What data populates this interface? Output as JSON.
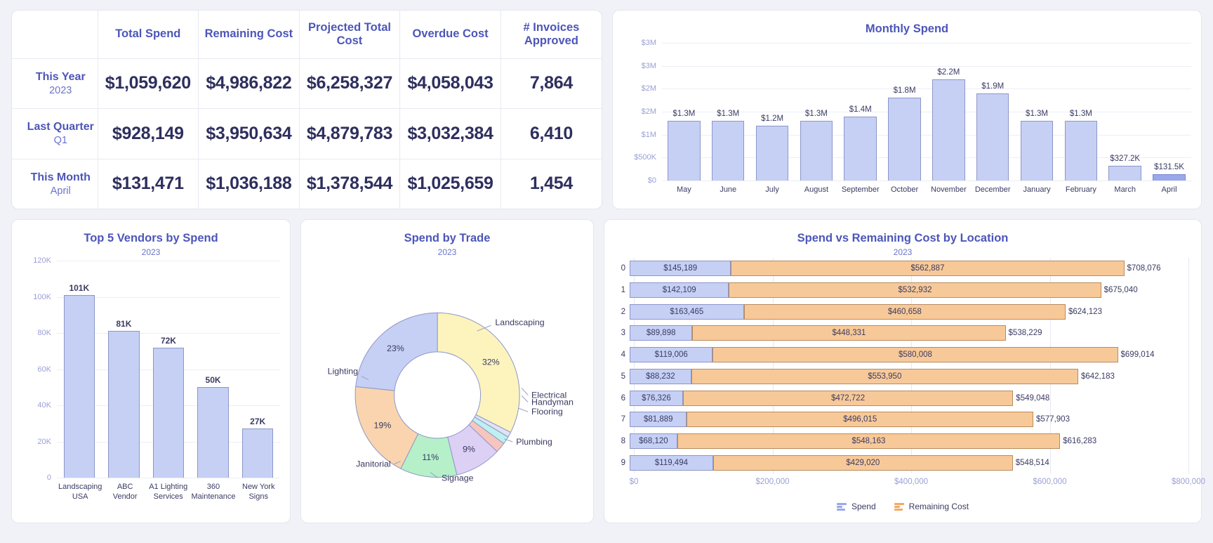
{
  "kpi_table": {
    "columns": [
      "",
      "Total Spend",
      "Remaining Cost",
      "Projected Total Cost",
      "Overdue Cost",
      "# Invoices Approved"
    ],
    "rows": [
      {
        "label": "This Year",
        "sub": "2023",
        "total_spend": "$1,059,620",
        "remaining_cost": "$4,986,822",
        "projected_total_cost": "$6,258,327",
        "overdue_cost": "$4,058,043",
        "invoices_approved": "7,864"
      },
      {
        "label": "Last Quarter",
        "sub": "Q1",
        "total_spend": "$928,149",
        "remaining_cost": "$3,950,634",
        "projected_total_cost": "$4,879,783",
        "overdue_cost": "$3,032,384",
        "invoices_approved": "6,410"
      },
      {
        "label": "This Month",
        "sub": "April",
        "total_spend": "$131,471",
        "remaining_cost": "$1,036,188",
        "projected_total_cost": "$1,378,544",
        "overdue_cost": "$1,025,659",
        "invoices_approved": "1,454"
      }
    ]
  },
  "monthly_spend": {
    "title": "Monthly Spend"
  },
  "top_vendors": {
    "title": "Top 5 Vendors by Spend",
    "subtitle": "2023"
  },
  "spend_by_trade": {
    "title": "Spend by Trade",
    "subtitle": "2023"
  },
  "location": {
    "title": "Spend vs Remaining Cost by Location",
    "subtitle": "2023",
    "legend": [
      {
        "name": "Spend",
        "color": "#9aa8ec"
      },
      {
        "name": "Remaining Cost",
        "color": "#f5a960"
      }
    ]
  },
  "chart_data": [
    {
      "id": "monthly_spend",
      "type": "bar",
      "title": "Monthly Spend",
      "xlabel": "",
      "ylabel": "",
      "grid": true,
      "legend": "none",
      "ylim": [
        0,
        3000000
      ],
      "ytick_labels": [
        "$3M",
        "$3M",
        "$2M",
        "$2M",
        "$1M",
        "$500K",
        "$0"
      ],
      "ytick_values": [
        3000000,
        2500000,
        2000000,
        1500000,
        1000000,
        500000,
        0
      ],
      "categories": [
        "May",
        "June",
        "July",
        "August",
        "September",
        "October",
        "November",
        "December",
        "January",
        "February",
        "March",
        "April"
      ],
      "values": [
        1300000,
        1300000,
        1200000,
        1300000,
        1400000,
        1800000,
        2200000,
        1900000,
        1300000,
        1300000,
        327200,
        131500
      ],
      "data_labels": [
        "$1.3M",
        "$1.3M",
        "$1.2M",
        "$1.3M",
        "$1.4M",
        "$1.8M",
        "$2.2M",
        "$1.9M",
        "$1.3M",
        "$1.3M",
        "$327.2K",
        "$131.5K"
      ],
      "highlight_index": 11,
      "bar_color": "#c6d0f5",
      "highlight_color": "#9aa8ec"
    },
    {
      "id": "top_vendors",
      "type": "bar",
      "title": "Top 5 Vendors by Spend",
      "subtitle": "2023",
      "xlabel": "",
      "ylabel": "",
      "grid": true,
      "ylim": [
        0,
        120000
      ],
      "ytick_labels": [
        "120K",
        "100K",
        "80K",
        "60K",
        "40K",
        "20K",
        "0"
      ],
      "ytick_values": [
        120000,
        100000,
        80000,
        60000,
        40000,
        20000,
        0
      ],
      "categories": [
        "Landscaping USA",
        "ABC Vendor",
        "A1 Lighting Services",
        "360 Maintenance",
        "New York Signs"
      ],
      "values": [
        101000,
        81000,
        72000,
        50000,
        27000
      ],
      "data_labels": [
        "101K",
        "81K",
        "72K",
        "50K",
        "27K"
      ],
      "bar_color": "#c6d0f5"
    },
    {
      "id": "spend_by_trade",
      "type": "pie",
      "title": "Spend by Trade",
      "subtitle": "2023",
      "donut": true,
      "labels": [
        "Landscaping",
        "Electrical",
        "Handyman",
        "Flooring",
        "Plumbing",
        "Signage",
        "Janitorial",
        "Lighting"
      ],
      "values": [
        32,
        1,
        1.5,
        2,
        9,
        11,
        19,
        23
      ],
      "data_labels": [
        "32%",
        "",
        "",
        "",
        "9%",
        "11%",
        "19%",
        "23%"
      ],
      "colors": [
        "#fdf3bd",
        "#dfe3f3",
        "#bdf0ef",
        "#f6c5bd",
        "#ddd0f5",
        "#b6f0c9",
        "#f9d4ae",
        "#c6d0f5"
      ]
    },
    {
      "id": "location",
      "type": "bar",
      "orientation": "horizontal",
      "stacked": true,
      "title": "Spend vs Remaining Cost by Location",
      "subtitle": "2023",
      "grid": true,
      "xlim": [
        0,
        800000
      ],
      "xtick_labels": [
        "$0",
        "$200,000",
        "$400,000",
        "$600,000",
        "$800,000"
      ],
      "xtick_values": [
        0,
        200000,
        400000,
        600000,
        800000
      ],
      "categories": [
        "0",
        "1",
        "2",
        "3",
        "4",
        "5",
        "6",
        "7",
        "8",
        "9"
      ],
      "series": [
        {
          "name": "Spend",
          "color": "#c6d0f5",
          "values": [
            145189,
            142109,
            163465,
            89898,
            119006,
            88232,
            76326,
            81889,
            68120,
            119494
          ],
          "labels": [
            "$145,189",
            "$142,109",
            "$163,465",
            "$89,898",
            "$119,006",
            "$88,232",
            "$76,326",
            "$81,889",
            "$68,120",
            "$119,494"
          ]
        },
        {
          "name": "Remaining Cost",
          "color": "#f8c998",
          "values": [
            562887,
            532932,
            460658,
            448331,
            580008,
            553950,
            472722,
            496015,
            548163,
            429020
          ],
          "labels": [
            "$562,887",
            "$532,932",
            "$460,658",
            "$448,331",
            "$580,008",
            "$553,950",
            "$472,722",
            "$496,015",
            "$548,163",
            "$429,020"
          ]
        }
      ],
      "totals": [
        708076,
        675040,
        624123,
        538229,
        699014,
        642183,
        549048,
        577903,
        616283,
        548514
      ],
      "total_labels": [
        "$708,076",
        "$675,040",
        "$624,123",
        "$538,229",
        "$699,014",
        "$642,183",
        "$549,048",
        "$577,903",
        "$616,283",
        "$548,514"
      ]
    }
  ]
}
